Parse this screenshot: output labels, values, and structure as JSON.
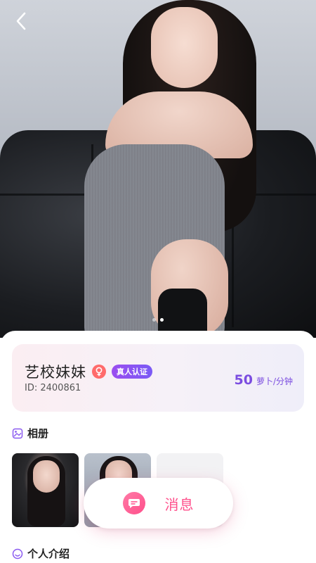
{
  "profile": {
    "name": "艺校妹妹",
    "verify_label": "真人认证",
    "id_text": "ID: 2400861",
    "price_value": "50",
    "price_unit": "萝卜/分钟"
  },
  "sections": {
    "album_title": "相册",
    "intro_title": "个人介绍"
  },
  "actions": {
    "message_label": "消息"
  },
  "carousel": {
    "total": 2,
    "active": 1
  },
  "colors": {
    "accent": "#7b4de0",
    "message_pink": "#ff4f8b",
    "gender_badge": "#ff6b6b"
  },
  "icons": {
    "back": "chevron-left-icon",
    "gender": "female-symbol-icon",
    "album": "image-icon",
    "intro": "smile-icon",
    "message": "chat-bubble-icon"
  }
}
